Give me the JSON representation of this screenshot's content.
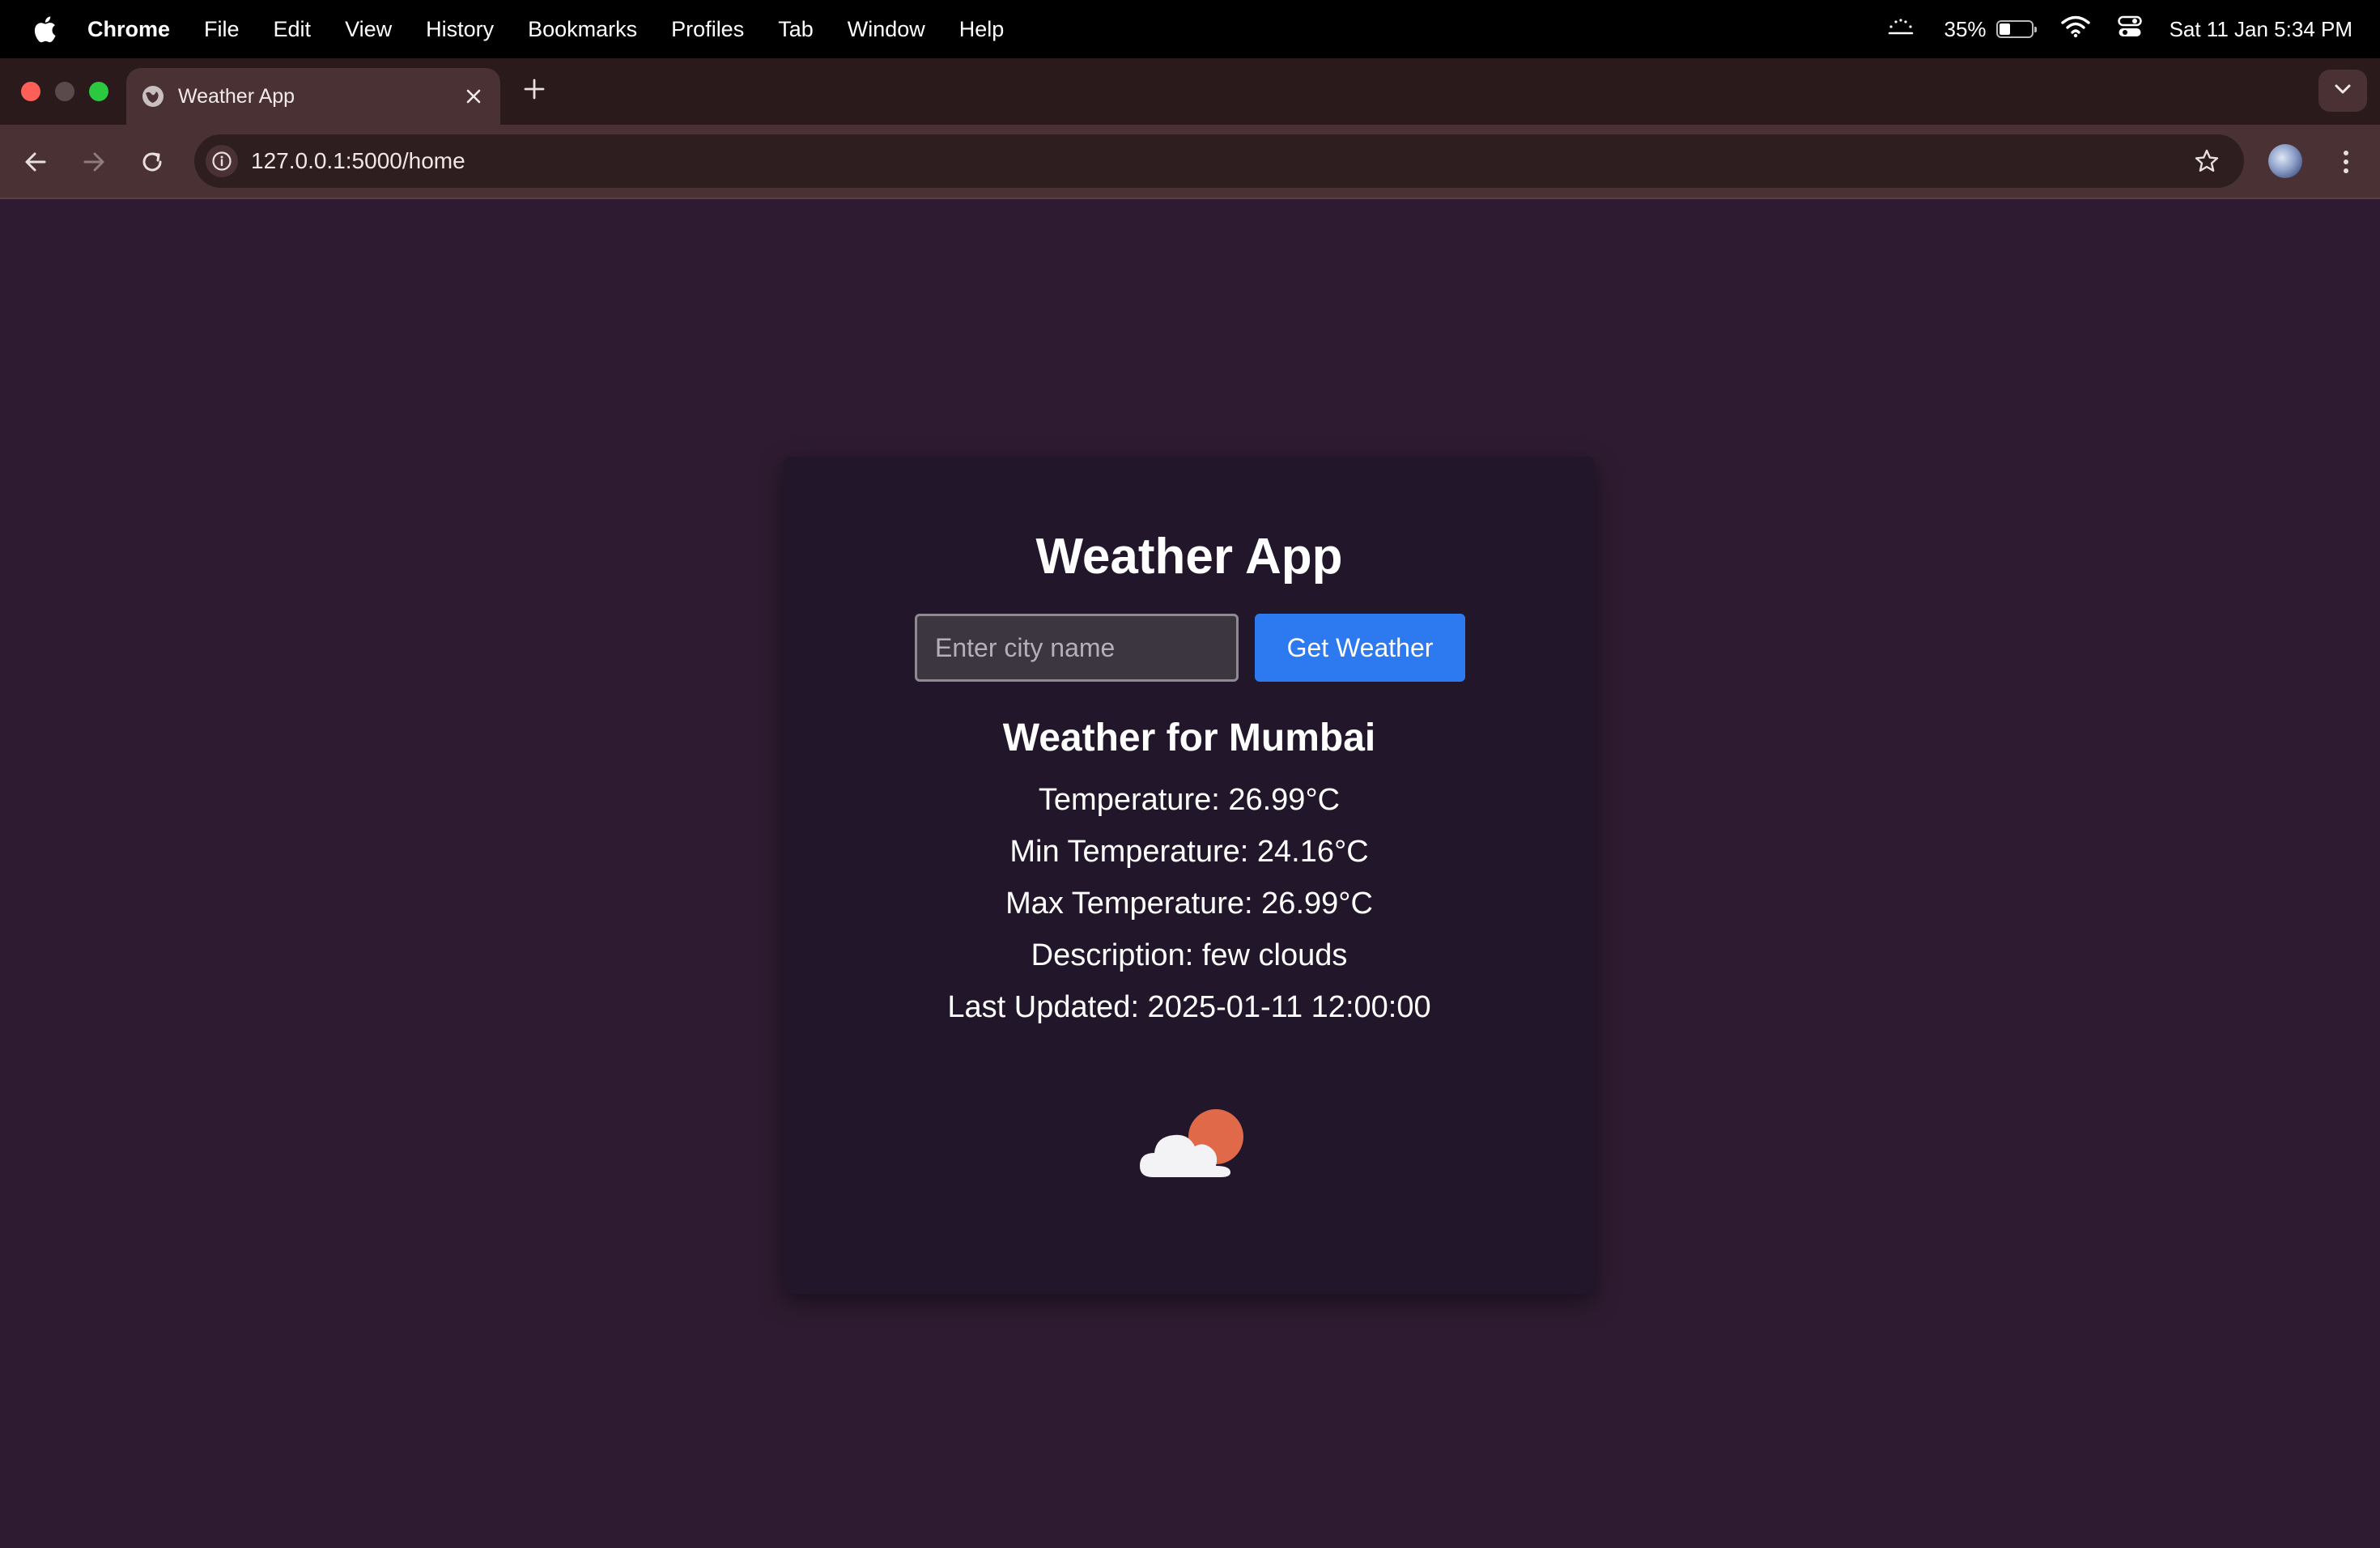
{
  "menubar": {
    "app_name": "Chrome",
    "menus": [
      "File",
      "Edit",
      "View",
      "History",
      "Bookmarks",
      "Profiles",
      "Tab",
      "Window",
      "Help"
    ],
    "battery_percent": "35%",
    "battery_level": 0.35,
    "datetime": "Sat 11 Jan  5:34 PM"
  },
  "browser": {
    "tab_title": "Weather App",
    "url": "127.0.0.1:5000/home"
  },
  "app": {
    "title": "Weather App",
    "city_placeholder": "Enter city name",
    "city_value": "",
    "button_label": "Get Weather",
    "weather_title": "Weather for Mumbai",
    "lines": {
      "temperature": "Temperature: 26.99°C",
      "min_temperature": "Min Temperature: 24.16°C",
      "max_temperature": "Max Temperature: 26.99°C",
      "description": "Description: few clouds",
      "last_updated": "Last Updated: 2025-01-11 12:00:00"
    },
    "weather_icon": "few-clouds-icon"
  },
  "colors": {
    "page_bg": "#2e1b31",
    "card_bg": "#22172a",
    "button": "#2d79f0",
    "sun": "#e0694a"
  }
}
